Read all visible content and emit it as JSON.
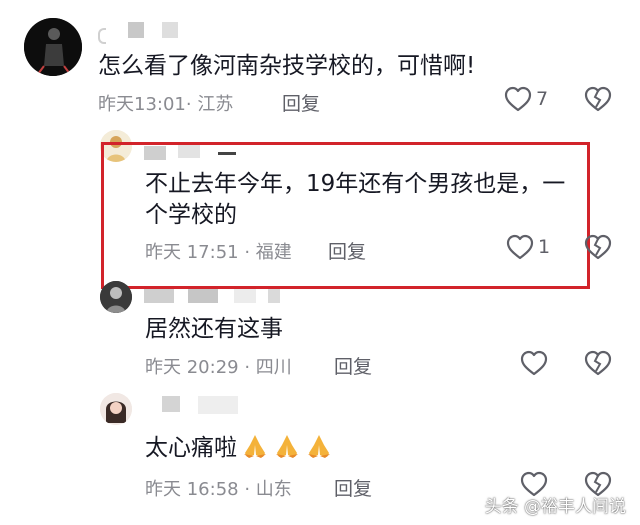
{
  "comments": [
    {
      "text": "怎么看了像河南杂技学校的，可惜啊!",
      "meta": "昨天13:01· 江苏",
      "reply_label": "回复",
      "likes": "7"
    },
    {
      "text_line1": "不止去年今年，19年还有个男孩也是，一",
      "text_line2": "个学校的",
      "meta": "昨天 17:51 · 福建",
      "reply_label": "回复",
      "likes": "1"
    },
    {
      "text": "居然还有这事",
      "meta": "昨天 20:29 · 四川",
      "reply_label": "回复"
    },
    {
      "text": "太心痛啦",
      "meta": "昨天 16:58 · 山东",
      "reply_label": "回复"
    }
  ],
  "emoji_names": [
    "pray-icon",
    "pray-icon",
    "pray-icon"
  ],
  "watermark": "头条 @裕丰人间说",
  "colors": {
    "highlight_border": "#d2232a",
    "meta_text": "#8a8b91",
    "primary_text": "#161823"
  }
}
